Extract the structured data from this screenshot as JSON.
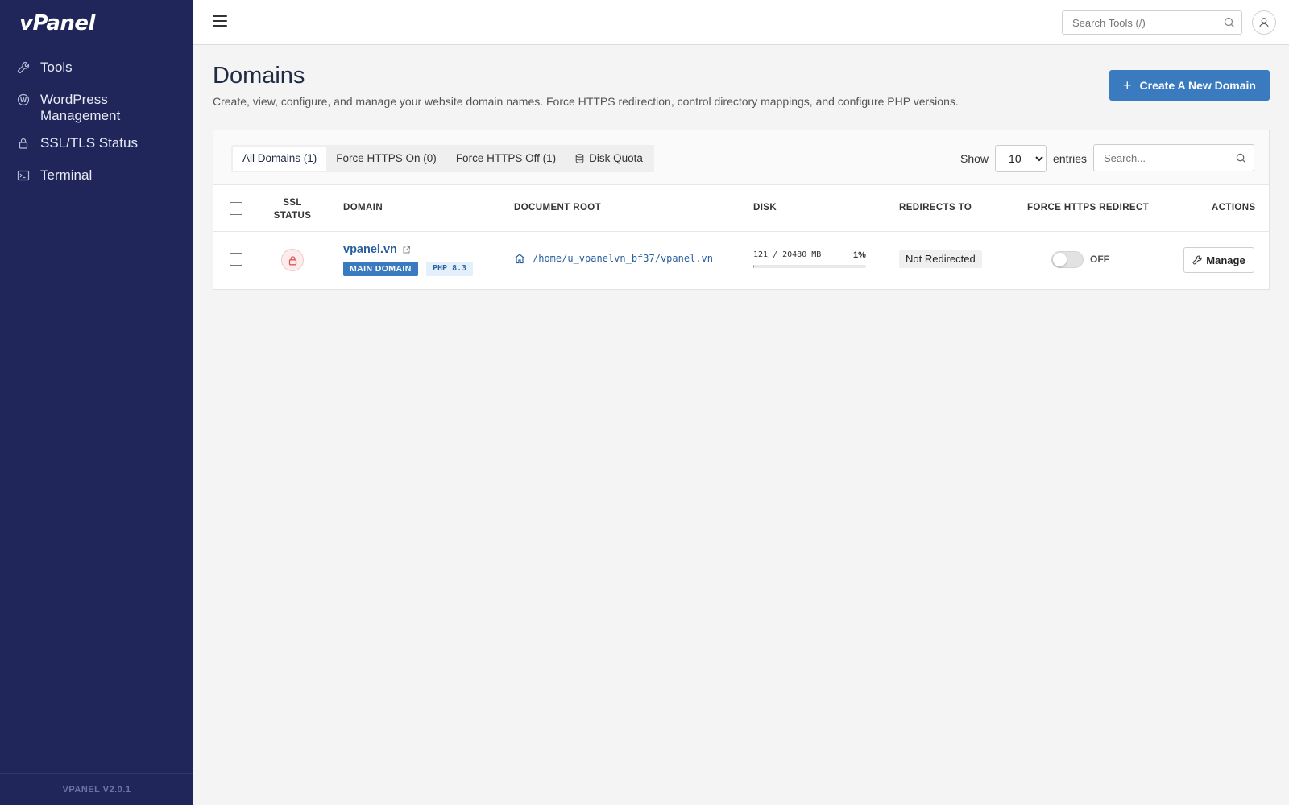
{
  "app": {
    "logo": "vPanel",
    "version": "VPANEL V2.0.1"
  },
  "sidebar": {
    "items": [
      {
        "label": "Tools",
        "icon": "wrench-icon"
      },
      {
        "label": "WordPress Management",
        "icon": "wordpress-icon"
      },
      {
        "label": "SSL/TLS Status",
        "icon": "lock-icon"
      },
      {
        "label": "Terminal",
        "icon": "terminal-icon"
      }
    ]
  },
  "topbar": {
    "search_placeholder": "Search Tools (/)"
  },
  "page": {
    "title": "Domains",
    "description": "Create, view, configure, and manage your website domain names. Force HTTPS redirection, control directory mappings, and configure PHP versions.",
    "create_button": "Create A New Domain"
  },
  "tabs": [
    {
      "label": "All Domains (1)",
      "active": true
    },
    {
      "label": "Force HTTPS On (0)",
      "active": false
    },
    {
      "label": "Force HTTPS Off (1)",
      "active": false
    },
    {
      "label": "Disk Quota",
      "active": false,
      "icon": "database-icon"
    }
  ],
  "table_controls": {
    "show_label": "Show",
    "entries_value": "10",
    "entries_label": "entries",
    "search_placeholder": "Search..."
  },
  "columns": {
    "ssl_status": "SSL\nSTATUS",
    "ssl_line1": "SSL",
    "ssl_line2": "STATUS",
    "domain": "DOMAIN",
    "document_root": "DOCUMENT ROOT",
    "disk": "DISK",
    "redirects_to": "REDIRECTS TO",
    "force_https": "FORCE HTTPS REDIRECT",
    "actions": "ACTIONS"
  },
  "rows": [
    {
      "domain": "vpanel.vn",
      "badge_main": "MAIN DOMAIN",
      "badge_php": "PHP 8.3",
      "document_root": "/home/u_vpanelvn_bf37/vpanel.vn",
      "disk_usage": "121 / 20480 MB",
      "disk_percent_label": "1%",
      "disk_fraction": 0.006,
      "redirects_to": "Not Redirected",
      "force_https_state": "OFF",
      "action_label": "Manage",
      "ssl_state": "insecure"
    }
  ],
  "colors": {
    "sidebar_bg": "#20265a",
    "accent": "#3a7abf",
    "link": "#2a5f9e",
    "ssl_insecure": "#e05454"
  }
}
